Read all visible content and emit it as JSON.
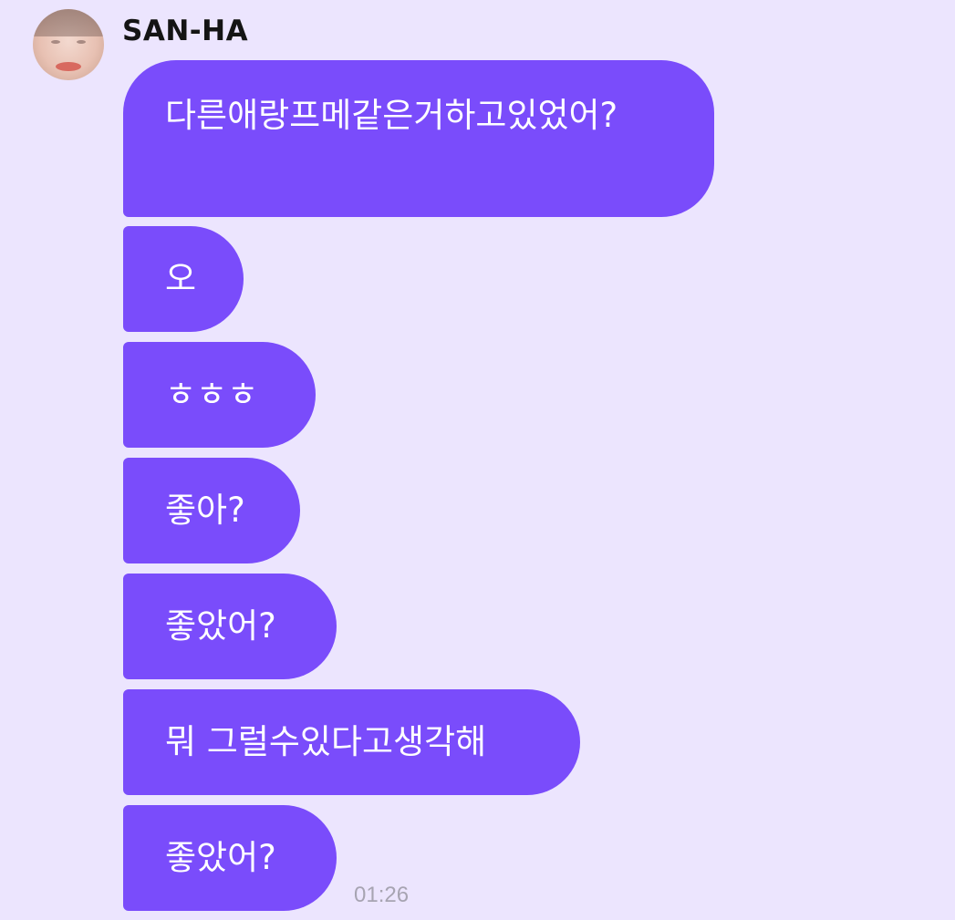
{
  "chat": {
    "sender_name": "SAN-HA",
    "messages": [
      "다른애랑프메같은거하고있었어?",
      "오",
      "ㅎㅎㅎ",
      "좋아?",
      "좋았어?",
      "뭐 그럴수있다고생각해",
      "좋았어?"
    ],
    "last_timestamp": "01:26"
  },
  "colors": {
    "background": "#ece5fe",
    "bubble": "#7a4cfb",
    "bubble_text": "#ffffff",
    "timestamp": "#a7a4b2"
  }
}
